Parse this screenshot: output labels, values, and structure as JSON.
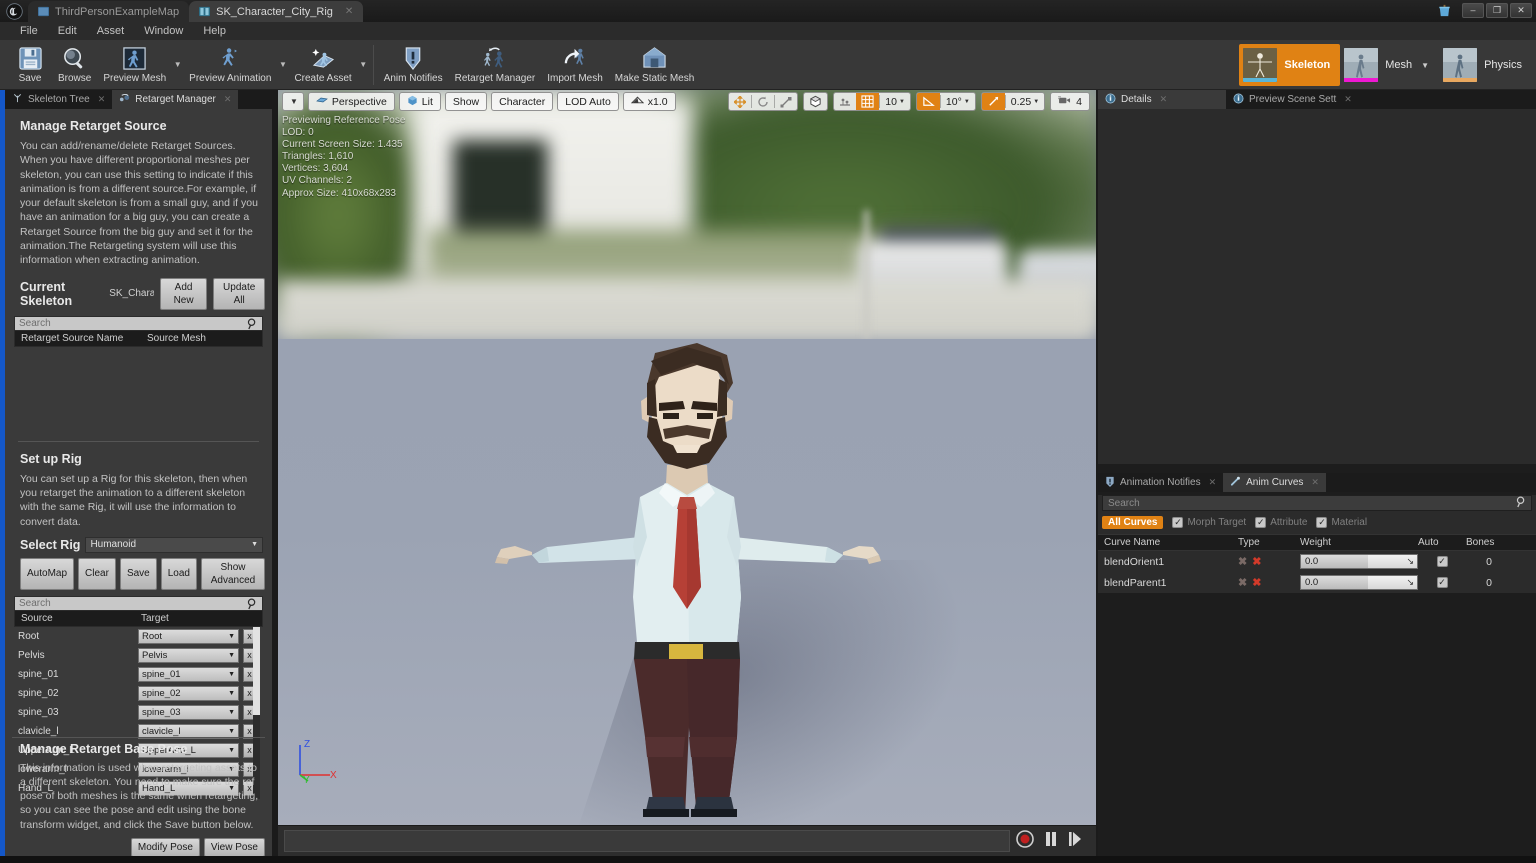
{
  "window": {
    "tabs": [
      {
        "label": "ThirdPersonExampleMap",
        "active": false,
        "icon": "map-tab-icon"
      },
      {
        "label": "SK_Character_City_Rig",
        "active": true,
        "icon": "skeleton-tab-icon"
      }
    ],
    "controls": {
      "minimize": "–",
      "maximize": "❐",
      "close": "✕"
    },
    "trash_icon": "trash-icon"
  },
  "menu": {
    "items": [
      "File",
      "Edit",
      "Asset",
      "Window",
      "Help"
    ]
  },
  "toolbar": {
    "buttons": [
      {
        "label": "Save",
        "icon": "save-icon",
        "caret": false
      },
      {
        "label": "Browse",
        "icon": "browse-magnifier-icon",
        "caret": false
      },
      {
        "label": "Preview Mesh",
        "icon": "preview-mesh-icon",
        "caret": true
      },
      {
        "label": "Preview Animation",
        "icon": "preview-animation-icon",
        "caret": true
      },
      {
        "label": "Create Asset",
        "icon": "create-asset-icon",
        "caret": true
      },
      {
        "label": "Anim Notifies",
        "icon": "anim-notifies-icon",
        "caret": false
      },
      {
        "label": "Retarget Manager",
        "icon": "retarget-manager-icon",
        "caret": false
      },
      {
        "label": "Import Mesh",
        "icon": "import-mesh-icon",
        "caret": false
      },
      {
        "label": "Make Static Mesh",
        "icon": "make-static-mesh-icon",
        "caret": false
      }
    ],
    "modes": [
      {
        "label": "Skeleton",
        "active": true,
        "accent": "#5ab5d8",
        "caret": false
      },
      {
        "label": "Mesh",
        "active": false,
        "accent": "#ee18d2",
        "caret": true
      },
      {
        "label": "Physics",
        "active": false,
        "accent": "#e8a860",
        "caret": false
      }
    ],
    "accent_color": "#e08214"
  },
  "left_panel": {
    "tabs": [
      {
        "label": "Skeleton Tree",
        "active": false,
        "icon": "skeleton-tree-icon"
      },
      {
        "label": "Retarget Manager",
        "active": true,
        "icon": "retarget-manager-icon"
      }
    ],
    "manage_source": {
      "title": "Manage Retarget Source",
      "description": "You can add/rename/delete Retarget Sources. When you have different proportional meshes per skeleton, you can use this setting to indicate if this animation is from a different source.For example, if your default skeleton is from a small guy, and if you have an animation for a big guy, you can create a Retarget Source from the big guy and set it for the animation.The Retargeting system will use this information when extracting animation.",
      "current_skeleton_label": "Current Skeleton",
      "current_skeleton_value": "SK_Charac",
      "add_new_label": "Add New",
      "update_all_label": "Update All",
      "search_placeholder": "Search",
      "columns": [
        "Retarget Source Name",
        "Source Mesh"
      ],
      "rows": []
    },
    "setup_rig": {
      "title": "Set up Rig",
      "description": "You can set up a Rig for this skeleton, then when you retarget the animation to a different skeleton with the same Rig, it will use the information to convert data.",
      "select_rig_label": "Select Rig",
      "select_rig_value": "Humanoid",
      "buttons": [
        "AutoMap",
        "Clear",
        "Save",
        "Load",
        "Show Advanced"
      ],
      "search_placeholder": "Search",
      "columns": [
        "Source",
        "Target"
      ],
      "mappings": [
        {
          "source": "Root",
          "target": "Root"
        },
        {
          "source": "Pelvis",
          "target": "Pelvis"
        },
        {
          "source": "spine_01",
          "target": "spine_01"
        },
        {
          "source": "spine_02",
          "target": "spine_02"
        },
        {
          "source": "spine_03",
          "target": "spine_03"
        },
        {
          "source": "clavicle_l",
          "target": "clavicle_l"
        },
        {
          "source": "UpperArm_L",
          "target": "UpperArm_L"
        },
        {
          "source": "lowerarm_l",
          "target": "lowerarm_l"
        },
        {
          "source": "Hand_L",
          "target": "Hand_L"
        }
      ],
      "clear_label": "x"
    },
    "base_pose": {
      "title": "Manage Retarget Base Pose",
      "description": "This information is used when retargeting assets to a different skeleton. You need to make sure the ref pose of both meshes is the same when retargeting, so you can see the pose and edit using the bone transform widget, and click the Save button below.",
      "modify_label": "Modify Pose",
      "view_label": "View Pose"
    }
  },
  "viewport": {
    "toolbar_left": [
      {
        "label": "Perspective",
        "icon": "perspective-icon"
      },
      {
        "label": "Lit",
        "icon": "lit-cube-icon"
      },
      {
        "label": "Show",
        "icon": ""
      },
      {
        "label": "Character",
        "icon": ""
      },
      {
        "label": "LOD Auto",
        "icon": ""
      },
      {
        "label": "x1.0",
        "icon": "playback-speed-icon"
      }
    ],
    "toolbar_right": {
      "transform_tools": [
        "move-icon",
        "rotate-icon",
        "scale-icon"
      ],
      "coord_space": "world-cube-icon",
      "surface_snap": "surface-snap-icon",
      "grid_snap_on": true,
      "grid_snap_value": "10",
      "angle_snap_on": true,
      "angle_snap_value": "10°",
      "scale_snap_on": true,
      "scale_snap_value": "0.25",
      "camera_speed_icon": "camera-speed-icon",
      "camera_speed_value": "4"
    },
    "stats": [
      "Previewing Reference Pose",
      "LOD: 0",
      "Current Screen Size: 1.435",
      "Triangles: 1,610",
      "Vertices: 3,604",
      "UV Channels: 2",
      "Approx Size: 410x68x283"
    ],
    "axis_gizmo": {
      "x": "X",
      "y": "Y",
      "z": "Z",
      "x_color": "#e03030",
      "y_color": "#2fbe2f",
      "z_color": "#3050e0"
    },
    "character": {
      "shirt_color": "#dce9ec",
      "tie_color": "#b04038",
      "pants_color": "#4a2b2b",
      "hair_color": "#3a2b22",
      "skin_color": "#e8d8c4",
      "belt_buckle_color": "#d7b63e",
      "shoe_color": "#2b3240"
    }
  },
  "transport": {
    "record_icon": "record-icon",
    "pause_icon": "pause-icon",
    "step_icon": "step-forward-icon"
  },
  "right_panel": {
    "top_tabs": [
      {
        "label": "Details",
        "active": true,
        "icon": "details-icon"
      },
      {
        "label": "Preview Scene Sett",
        "active": false,
        "icon": "preview-scene-icon"
      }
    ],
    "bottom_tabs": [
      {
        "label": "Animation Notifies",
        "active": false,
        "icon": "anim-notifies-icon"
      },
      {
        "label": "Anim Curves",
        "active": true,
        "icon": "anim-curves-icon"
      }
    ],
    "curves": {
      "search_placeholder": "Search",
      "filter_pill": "All Curves",
      "filters": [
        {
          "label": "Morph Target",
          "checked": true
        },
        {
          "label": "Attribute",
          "checked": true
        },
        {
          "label": "Material",
          "checked": true
        }
      ],
      "columns": [
        "Curve Name",
        "Type",
        "Weight",
        "Auto",
        "Bones"
      ],
      "rows": [
        {
          "name": "blendOrient1",
          "type_icons": [
            "x-gray-icon",
            "x-red-icon"
          ],
          "weight": "0.0",
          "auto": true,
          "bones": "0"
        },
        {
          "name": "blendParent1",
          "type_icons": [
            "x-gray-icon",
            "x-red-icon"
          ],
          "weight": "0.0",
          "auto": true,
          "bones": "0"
        }
      ]
    }
  }
}
